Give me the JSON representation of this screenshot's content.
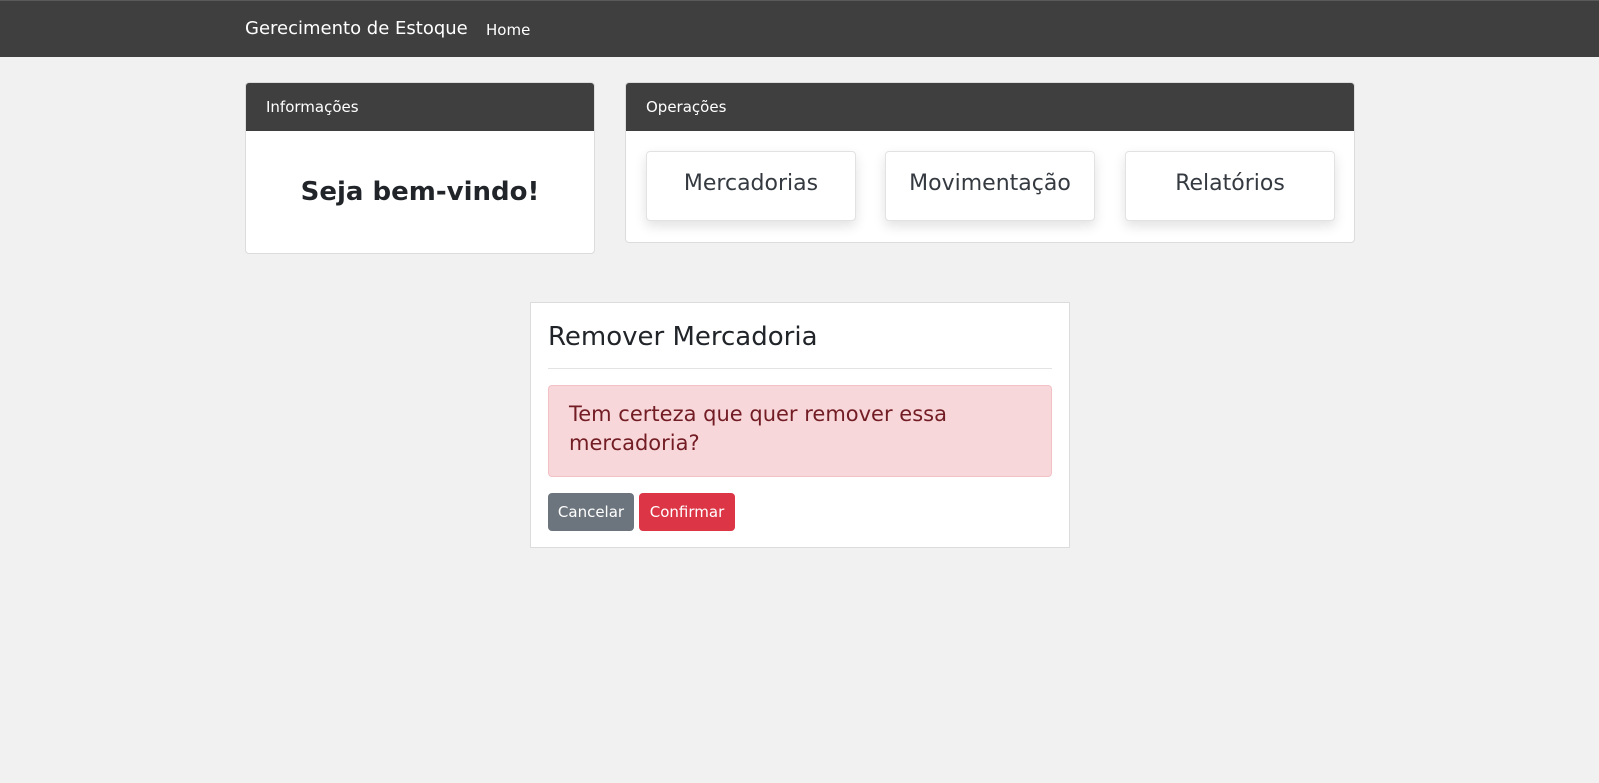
{
  "navbar": {
    "brand": "Gerecimento de Estoque",
    "links": [
      "Home"
    ]
  },
  "info_card": {
    "header": "Informações",
    "welcome": "Seja bem-vindo!"
  },
  "operations_card": {
    "header": "Operações",
    "buttons": [
      "Mercadorias",
      "Movimentação",
      "Relatórios"
    ]
  },
  "remove_dialog": {
    "title": "Remover Mercadoria",
    "alert_text": "Tem certeza que quer remover essa mercadoria?",
    "cancel_label": "Cancelar",
    "confirm_label": "Confirmar"
  },
  "colors": {
    "navbar_bg": "#3f3f3f",
    "page_bg": "#f1f1f1",
    "alert_bg": "#f8d7da",
    "alert_text": "#721c24",
    "cancel_bg": "#6c757d",
    "confirm_bg": "#dc3545"
  }
}
